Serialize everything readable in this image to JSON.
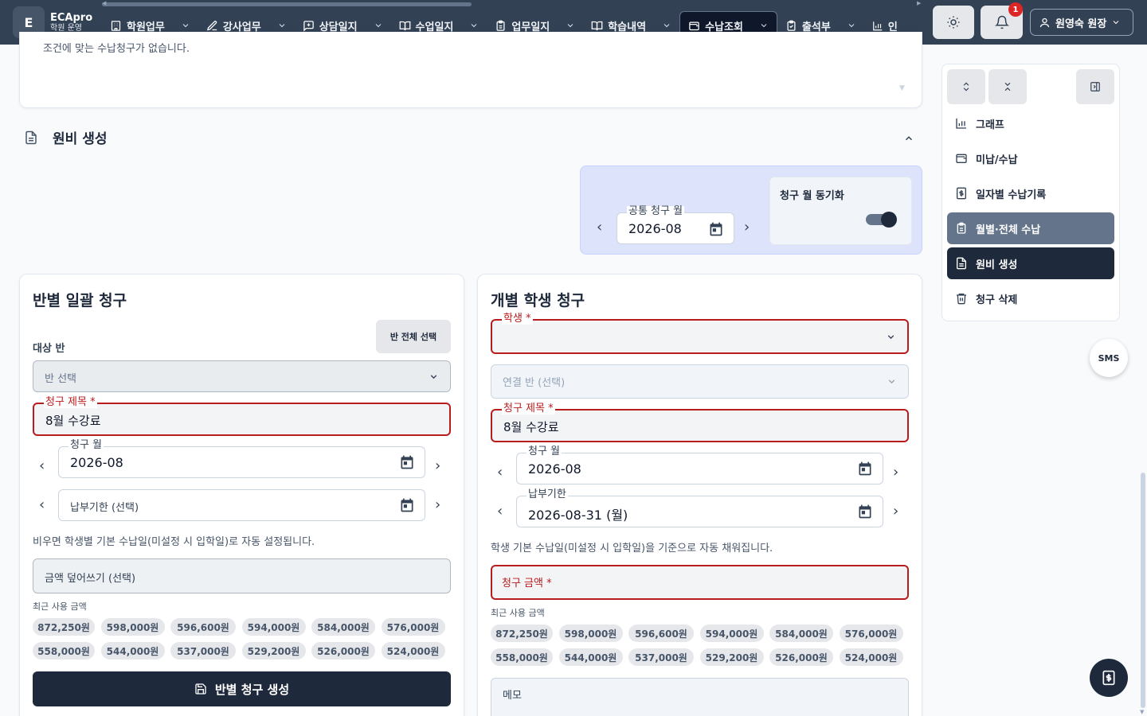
{
  "brand": {
    "logo_letter": "E",
    "name": "ECApro",
    "subtitle": "학원 운영"
  },
  "nav": {
    "items": [
      {
        "label": "학원업무",
        "icon": "building-icon"
      },
      {
        "label": "강사업무",
        "icon": "edit-icon"
      },
      {
        "label": "상담일지",
        "icon": "chat-plus-icon"
      },
      {
        "label": "수업일지",
        "icon": "book-icon"
      },
      {
        "label": "업무일지",
        "icon": "clipboard-icon"
      },
      {
        "label": "학습내역",
        "icon": "book-open-icon"
      },
      {
        "label": "수납조회",
        "icon": "wallet-icon",
        "active": true
      },
      {
        "label": "출석부",
        "icon": "clipboard-check-icon"
      },
      {
        "label": "인",
        "icon": "chart-icon"
      }
    ]
  },
  "notifications": {
    "count": "1"
  },
  "user": {
    "label": "원영숙 원장"
  },
  "top_card": {
    "empty_text": "조건에 맞는 수납청구가 없습니다."
  },
  "section": {
    "title": "원비 생성"
  },
  "common_month": {
    "label": "공통 청구 월",
    "value": "2026-08",
    "sync_label": "청구 월 동기화",
    "sync_on": true
  },
  "class_bill": {
    "title": "반별 일괄 청구",
    "select_all": "반 전체 선택",
    "target_label": "대상 반",
    "class_placeholder": "반 선택",
    "bill_title_label": "청구 제목 *",
    "bill_title_value": "8월 수강료",
    "month_label": "청구 월",
    "month_value": "2026-08",
    "due_placeholder": "납부기한 (선택)",
    "help": "비우면 학생별 기본 수납일(미설정 시 입학일)로 자동 설정됩니다.",
    "amount_placeholder": "금액 덮어쓰기 (선택)",
    "recent_label": "최근 사용 금액",
    "submit": "반별 청구 생성"
  },
  "student_bill": {
    "title": "개별 학생 청구",
    "student_label": "학생 *",
    "linked_class_placeholder": "연결 반 (선택)",
    "bill_title_label": "청구 제목 *",
    "bill_title_value": "8월 수강료",
    "month_label": "청구 월",
    "month_value": "2026-08",
    "due_label": "납부기한",
    "due_value": "2026-08-31 (월)",
    "help": "학생 기본 수납일(미설정 시 입학일)을 기준으로 자동 채워집니다.",
    "amount_label": "청구 금액 *",
    "recent_label": "최근 사용 금액",
    "memo_placeholder": "메모"
  },
  "recent_amounts": [
    "872,250원",
    "598,000원",
    "596,600원",
    "594,000원",
    "584,000원",
    "576,000원",
    "558,000원",
    "544,000원",
    "537,000원",
    "529,200원",
    "526,000원",
    "524,000원"
  ],
  "sidebar": {
    "items": [
      {
        "label": "그래프",
        "icon": "bar-chart-icon"
      },
      {
        "label": "미납/수납",
        "icon": "wallet-icon"
      },
      {
        "label": "일자별 수납기록",
        "icon": "dollar-doc-icon"
      },
      {
        "label": "월별·전체 수납",
        "icon": "clipboard-icon",
        "state": "selected"
      },
      {
        "label": "원비 생성",
        "icon": "document-icon",
        "state": "active"
      },
      {
        "label": "청구 삭제",
        "icon": "trash-icon"
      }
    ]
  },
  "sms_label": "SMS",
  "colors": {
    "nav_bg": "#334155",
    "active_dark": "#1e293b",
    "required_red": "#b91c1c",
    "month_panel": "#dde3fb"
  }
}
